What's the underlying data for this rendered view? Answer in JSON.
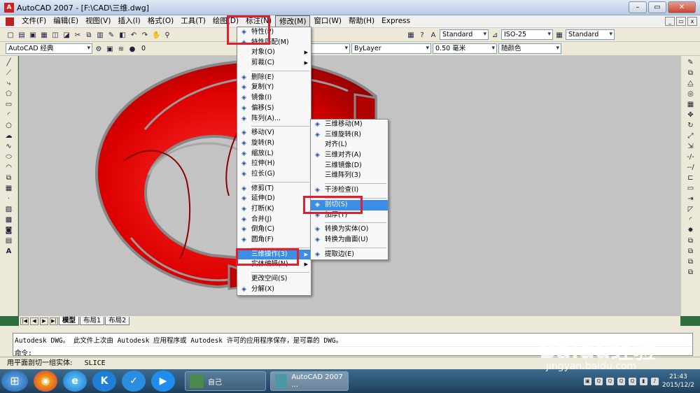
{
  "title": "AutoCAD 2007 - [F:\\CAD\\三维.dwg]",
  "menubar": [
    "文件(F)",
    "编辑(E)",
    "视图(V)",
    "插入(I)",
    "格式(O)",
    "工具(T)",
    "绘图(D)",
    "标注(N)",
    "修改(M)",
    "窗口(W)",
    "帮助(H)",
    "Express"
  ],
  "active_menu": "修改(M)",
  "toolbar1": {
    "text_style": "Standard",
    "dim_style": "ISO-25",
    "table_style": "Standard"
  },
  "toolbar2": {
    "workspace": "AutoCAD 经典",
    "layer": "0",
    "color": "红",
    "linetype": "ByLayer",
    "lineweight": "0.50 毫米",
    "plotstyle": "随颜色"
  },
  "modify_menu": [
    {
      "label": "特性(P)",
      "icon": "properties-icon"
    },
    {
      "label": "特性匹配(M)",
      "icon": "match-properties-icon"
    },
    {
      "label": "对象(O)",
      "arrow": true
    },
    {
      "label": "剪裁(C)",
      "arrow": true
    },
    {
      "sep": true
    },
    {
      "label": "删除(E)",
      "icon": "erase-icon"
    },
    {
      "label": "复制(Y)",
      "icon": "copy-icon"
    },
    {
      "label": "镜像(I)",
      "icon": "mirror-icon"
    },
    {
      "label": "偏移(S)",
      "icon": "offset-icon"
    },
    {
      "label": "阵列(A)...",
      "icon": "array-icon"
    },
    {
      "sep": true
    },
    {
      "label": "移动(V)",
      "icon": "move-icon"
    },
    {
      "label": "旋转(R)",
      "icon": "rotate-icon"
    },
    {
      "label": "缩放(L)",
      "icon": "scale-icon"
    },
    {
      "label": "拉伸(H)",
      "icon": "stretch-icon"
    },
    {
      "label": "拉长(G)",
      "icon": "lengthen-icon"
    },
    {
      "sep": true
    },
    {
      "label": "修剪(T)",
      "icon": "trim-icon"
    },
    {
      "label": "延伸(D)",
      "icon": "extend-icon"
    },
    {
      "label": "打断(K)",
      "icon": "break-icon"
    },
    {
      "label": "合并(J)",
      "icon": "join-icon"
    },
    {
      "label": "倒角(C)",
      "icon": "chamfer-icon"
    },
    {
      "label": "圆角(F)",
      "icon": "fillet-icon"
    },
    {
      "sep": true
    },
    {
      "label": "三维操作(3)",
      "arrow": true,
      "highlight": true
    },
    {
      "label": "实体编辑(N)",
      "arrow": true
    },
    {
      "sep": true
    },
    {
      "label": "更改空间(S)"
    },
    {
      "label": "分解(X)",
      "icon": "explode-icon"
    }
  ],
  "submenu_3d": [
    {
      "label": "三维移动(M)",
      "icon": "3d-move-icon"
    },
    {
      "label": "三维旋转(R)",
      "icon": "3d-rotate-icon"
    },
    {
      "label": "对齐(L)"
    },
    {
      "label": "三维对齐(A)",
      "icon": "3d-align-icon"
    },
    {
      "label": "三维镜像(D)"
    },
    {
      "label": "三维阵列(3)"
    },
    {
      "sep": true
    },
    {
      "label": "干涉检查(I)",
      "icon": "interference-icon"
    },
    {
      "sep": true
    },
    {
      "label": "剖切(S)",
      "icon": "slice-icon",
      "highlight": true
    },
    {
      "label": "加厚(T)",
      "icon": "thicken-icon"
    },
    {
      "sep": true
    },
    {
      "label": "转换为实体(O)",
      "icon": "convert-solid-icon"
    },
    {
      "label": "转换为曲面(U)",
      "icon": "convert-surface-icon"
    },
    {
      "sep": true
    },
    {
      "label": "提取边(E)",
      "icon": "extract-edges-icon"
    }
  ],
  "layout_tabs": [
    "模型",
    "布局1",
    "布局2"
  ],
  "command_history": "Autodesk DWG。  此文件上次由 Autodesk 应用程序或 Autodesk 许可的应用程序保存，是可靠的 DWG。",
  "command_prompt": "命令:",
  "status_text": "用平面剖切一组实体:",
  "status_command": "SLICE",
  "taskbar": {
    "item1": "自己",
    "item2": "AutoCAD 2007 ...",
    "time": "21:43",
    "date": "2015/12/2"
  },
  "watermark": {
    "line1": "Baidu经验",
    "line2": "jingyan.baidu.com"
  },
  "colors": {
    "accent": "#3a8ee6",
    "highlight_box": "#e0202e",
    "model": "#e00000"
  }
}
